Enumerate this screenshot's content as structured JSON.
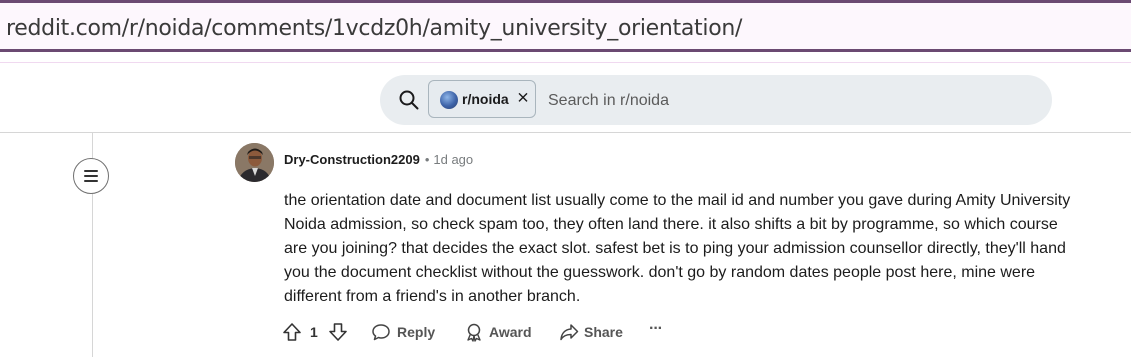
{
  "browser": {
    "url": "reddit.com/r/noida/comments/1vcdz0h/amity_university_orientation/"
  },
  "search": {
    "community_chip": "r/noida",
    "placeholder": "Search in r/noida",
    "value": ""
  },
  "comment": {
    "author": "Dry-Construction2209",
    "separator": "•",
    "timestamp": "1d ago",
    "body": "the orientation date and document list usually come to the mail id and number you gave during Amity University Noida admission, so check spam too, they often land there. it also shifts a bit by programme, so which course are you joining? that decides the exact slot. safest bet is to ping your admission counsellor directly, they'll hand you the document checklist without the guesswork. don't go by random dates people post here, mine were different from a friend's in another branch.",
    "vote_count": "1",
    "reply_label": "Reply",
    "award_label": "Award",
    "share_label": "Share",
    "more_label": "···"
  },
  "icons": [
    "search-icon",
    "close-icon",
    "collapse-icon",
    "upvote-icon",
    "downvote-icon",
    "reply-icon",
    "award-icon",
    "share-icon",
    "more-icon"
  ]
}
